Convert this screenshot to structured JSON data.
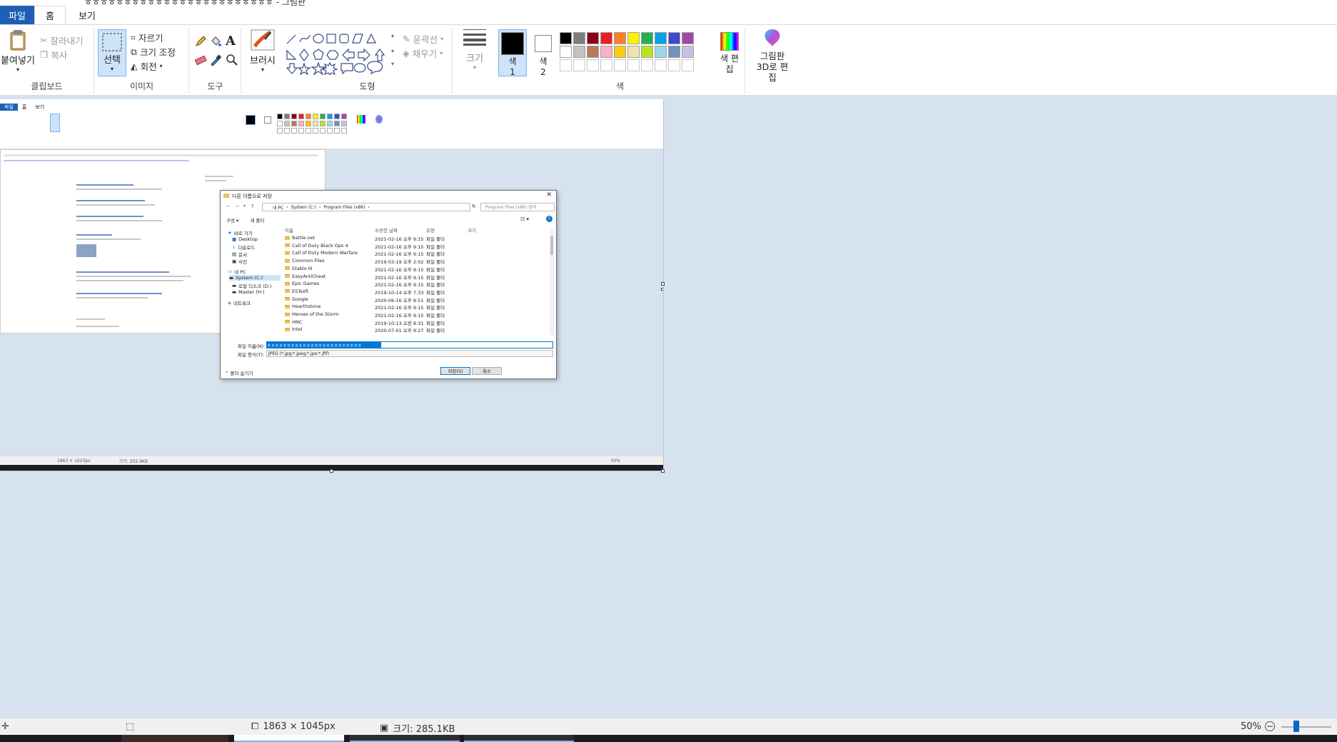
{
  "window": {
    "title": "ㅎㅎㅎㅎㅎㅎㅎㅎㅎㅎㅎㅎㅎㅎㅎㅎㅎㅎㅎㅎㅎㅎㅎㅎ - 그림판"
  },
  "tabs": [
    {
      "label": "파일"
    },
    {
      "label": "홈"
    },
    {
      "label": "보기"
    }
  ],
  "ribbon": {
    "clipboard": {
      "paste": "붙여넣기",
      "cut": "잘라내기",
      "copy": "복사",
      "label": "클립보드"
    },
    "image": {
      "select": "선택",
      "crop": "자르기",
      "resize": "크기 조정",
      "rotate": "회전",
      "label": "이미지"
    },
    "tools": {
      "label": "도구"
    },
    "brushes": {
      "label": "브러시"
    },
    "shapes": {
      "outline": "윤곽선",
      "fill": "채우기",
      "label": "도형"
    },
    "size": {
      "label": "크기"
    },
    "colors": {
      "color1": "색 1",
      "color2": "색 2",
      "edit": "색 편집",
      "label": "색",
      "palette_row1": [
        "#000000",
        "#7f7f7f",
        "#880015",
        "#ed1c24",
        "#ff7f27",
        "#fff200",
        "#22b14c",
        "#00a2e8",
        "#3f48cc",
        "#a349a4"
      ],
      "palette_row2": [
        "#ffffff",
        "#c3c3c3",
        "#b97a57",
        "#ffaec9",
        "#ffc90e",
        "#efe4b0",
        "#b5e61d",
        "#99d9ea",
        "#7092be",
        "#c8bfe7"
      ],
      "palette_row3": [
        "#ffffff",
        "#ffffff",
        "#ffffff",
        "#ffffff",
        "#ffffff",
        "#ffffff",
        "#ffffff",
        "#ffffff",
        "#ffffff",
        "#ffffff"
      ]
    },
    "paint3d": {
      "label": "그림판 3D로 편집"
    }
  },
  "dialog": {
    "title": "다른 이름으로 저장",
    "breadcrumb": [
      "내 PC",
      "System (C:)",
      "Program Files (x86)"
    ],
    "search_placeholder": "Program Files (x86) 검색",
    "toolbar": {
      "organize": "구성",
      "new_folder": "새 폴더"
    },
    "nav": [
      {
        "label": "바로 가기"
      },
      {
        "label": "Desktop"
      },
      {
        "label": "다운로드"
      },
      {
        "label": "문서"
      },
      {
        "label": "사진"
      },
      {
        "label": "내 PC"
      },
      {
        "label": "System (C:)"
      },
      {
        "label": "로컬 디스크 (D:)"
      },
      {
        "label": "Master (H:)"
      },
      {
        "label": "네트워크"
      }
    ],
    "columns": {
      "name": "이름",
      "modified": "수정한 날짜",
      "type": "유형",
      "size": "크기"
    },
    "rows": [
      {
        "name": "Battle.net",
        "date": "2021-02-16 오후 9:15",
        "type": "파일 폴더"
      },
      {
        "name": "Call of Duty Black Ops 4",
        "date": "2021-02-16 오후 9:15",
        "type": "파일 폴더"
      },
      {
        "name": "Call of Duty Modern Warfare",
        "date": "2021-02-16 오후 9:15",
        "type": "파일 폴더"
      },
      {
        "name": "Common Files",
        "date": "2019-03-19 오후 2:02",
        "type": "파일 폴더"
      },
      {
        "name": "Diablo III",
        "date": "2021-02-16 오후 9:15",
        "type": "파일 폴더"
      },
      {
        "name": "EasyAntiCheat",
        "date": "2021-02-16 오후 9:15",
        "type": "파일 폴더"
      },
      {
        "name": "Epic Games",
        "date": "2021-02-16 오후 9:15",
        "type": "파일 폴더"
      },
      {
        "name": "ESTsoft",
        "date": "2019-10-14 오후 7:33",
        "type": "파일 폴더"
      },
      {
        "name": "Google",
        "date": "2020-06-16 오후 8:51",
        "type": "파일 폴더"
      },
      {
        "name": "Hearthstone",
        "date": "2021-02-16 오후 9:15",
        "type": "파일 폴더"
      },
      {
        "name": "Heroes of the Storm",
        "date": "2021-02-16 오후 9:15",
        "type": "파일 폴더"
      },
      {
        "name": "HNC",
        "date": "2019-10-13 오전 8:31",
        "type": "파일 폴더"
      },
      {
        "name": "Intel",
        "date": "2020-07-01 오후 9:27",
        "type": "파일 폴더"
      }
    ],
    "filename_label": "파일 이름(N):",
    "filename_value": "ㅎㅎㅎㅎㅎㅎㅎㅎㅎㅎㅎㅎㅎㅎㅎㅎㅎㅎㅎㅎㅎㅎㅎㅎ",
    "filetype_label": "파일 형식(T):",
    "filetype_value": "JPEG (*.jpg;*.jpeg;*.jpe;*.jfif)",
    "hide_folders": "폴더 숨기기",
    "save": "저장(S)",
    "cancel": "취소"
  },
  "mini": {
    "tabs": [
      "파일",
      "홈",
      "보기"
    ],
    "status_dims": "1863 × 1023px",
    "status_size": "크기: 255.9KB",
    "zoom": "50%"
  },
  "statusbar": {
    "dimensions": "1863 × 1045px",
    "file_size": "크기: 285.1KB",
    "zoom": "50%"
  }
}
